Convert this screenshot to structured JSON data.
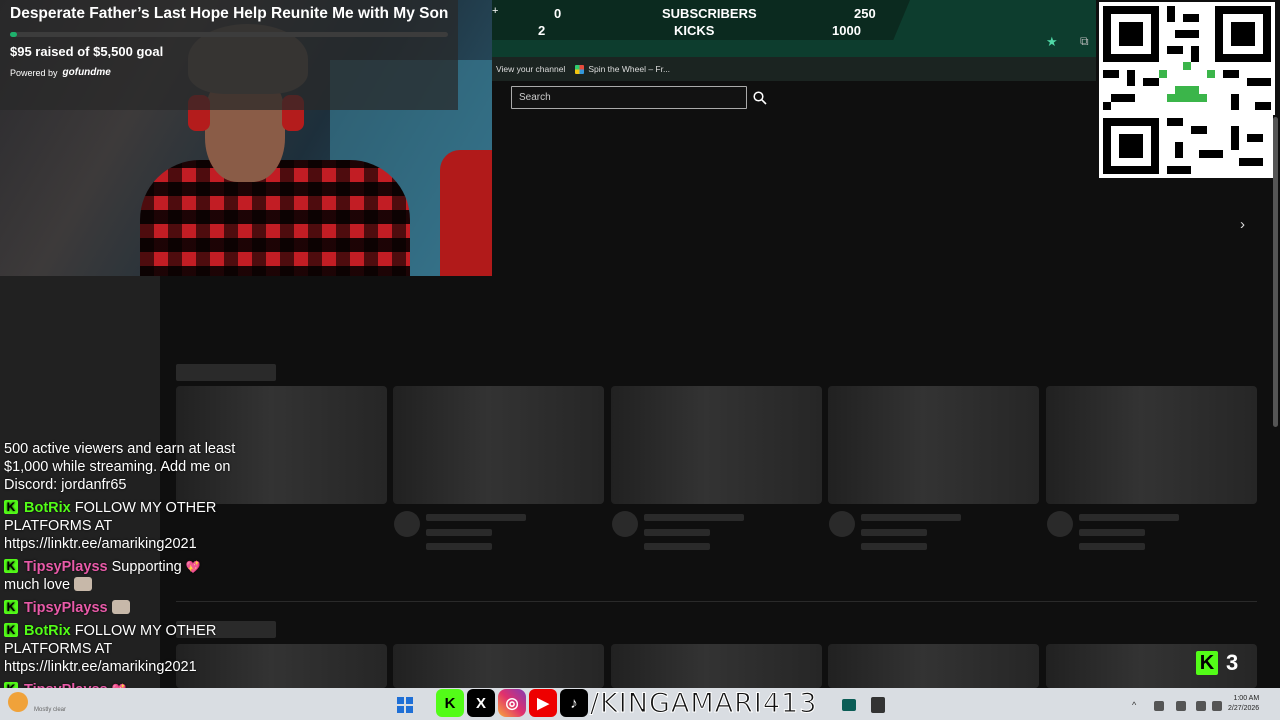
{
  "gofundme": {
    "title": "Desperate Father’s Last Hope Help Reunite Me with My Son",
    "raised_text": "$95 raised of $5,500 goal",
    "progress_fraction": 0.017,
    "powered_by": "Powered by",
    "logo": "gofundme"
  },
  "stats": {
    "plus": "+",
    "row1": {
      "left": "0",
      "label": "SUBSCRIBERS",
      "right": "250"
    },
    "row2": {
      "left": "2",
      "label": "KICKS",
      "right": "1000"
    }
  },
  "bookmarks": {
    "item1": "View your channel",
    "item2": "Spin the Wheel – Fr..."
  },
  "search": {
    "placeholder": "Search"
  },
  "chat": {
    "partial_line1": "500 active viewers and earn at least",
    "partial_line2": "$1,000 while streaming. Add me on",
    "partial_line3": "Discord: jordanfr65",
    "messages": [
      {
        "user": "BotRix",
        "text": "FOLLOW MY OTHER PLATFORMS AT https://linktr.ee/amariking2021"
      },
      {
        "user": "TipsyPlayss",
        "text": "Supporting",
        "text2": "much love"
      },
      {
        "user": "TipsyPlayss",
        "text": ""
      },
      {
        "user": "BotRix",
        "text": "FOLLOW MY OTHER PLATFORMS AT https://linktr.ee/amariking2021"
      },
      {
        "user": "TipsyPlayss",
        "text": ""
      }
    ]
  },
  "taskbar": {
    "weather": "Mostly clear",
    "time": "1:00 AM",
    "date": "2/27/2026",
    "handle": "/KINGAMARI413"
  },
  "social_icons": [
    "kick-icon",
    "x-icon",
    "instagram-icon",
    "youtube-icon",
    "tiktok-icon"
  ],
  "kick_count": "3",
  "colors": {
    "kick_green": "#53fc18",
    "tipsy_pink": "#e85aa8",
    "gofundme_green": "#1eb06c"
  }
}
